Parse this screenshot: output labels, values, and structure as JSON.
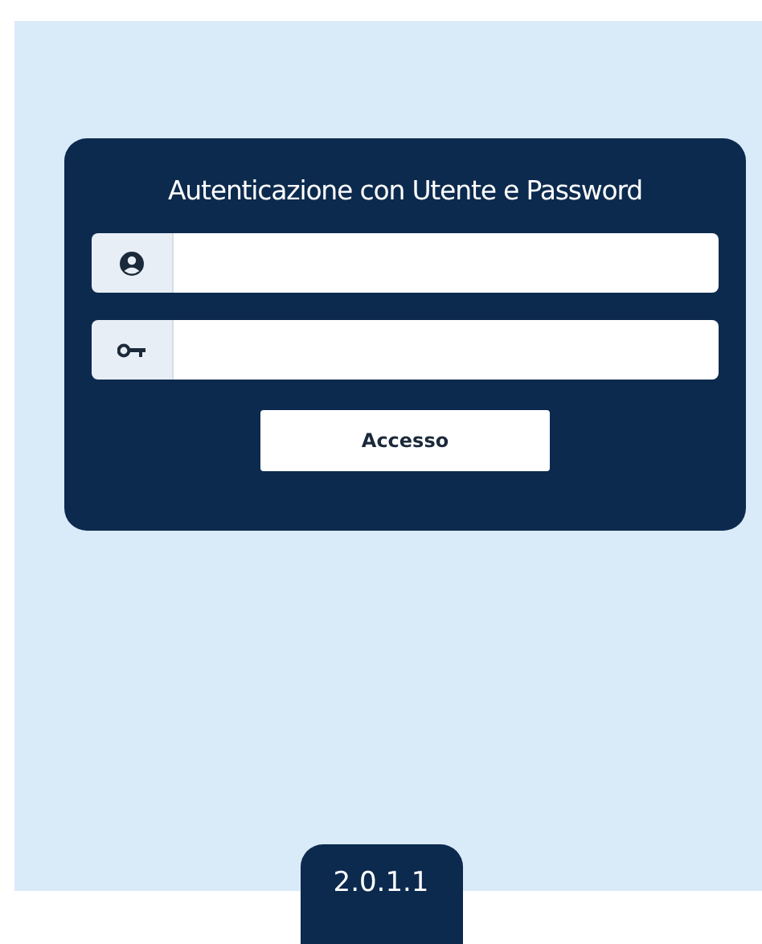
{
  "login": {
    "title": "Autenticazione con Utente e Password",
    "fields": [
      {
        "kind": "user"
      },
      {
        "kind": "password"
      }
    ],
    "button": "Accesso"
  },
  "version": "2.0.1.1"
}
